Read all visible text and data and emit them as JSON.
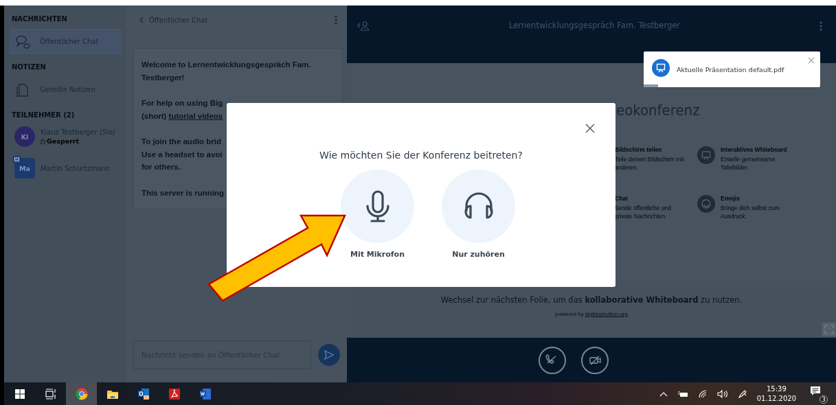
{
  "sidebar": {
    "sections": [
      {
        "title": "NACHRICHTEN",
        "items": [
          {
            "kind": "chat",
            "label": "Öffentlicher Chat",
            "selected": true
          }
        ]
      },
      {
        "title": "NOTIZEN",
        "items": [
          {
            "kind": "notes",
            "label": "Geteilte Notizen",
            "selected": false
          }
        ]
      }
    ],
    "participants": {
      "title": "TEILNEHMER (2)",
      "users": [
        {
          "kind": "viewer",
          "initials": "Kl",
          "name": "Klaus Testberger",
          "tag": "(Sie)",
          "status": "Gesperrt",
          "color": "#2b2766"
        },
        {
          "kind": "moderator",
          "initials": "Ma",
          "name": "Martin Schurtzmann",
          "color": "#1c3a70"
        }
      ]
    }
  },
  "chat": {
    "title": "Öffentlicher Chat",
    "paragraphs": [
      {
        "lines": [
          {
            "text": "Welcome to **Lernentwicklungsgespräch Fam.**"
          },
          {
            "text": "**Testberger**!"
          }
        ]
      },
      {
        "lines": [
          {
            "text": "For help on using Big"
          },
          {
            "text": "(short) ",
            "link": "tutorial videos"
          }
        ]
      },
      {
        "lines": [
          {
            "text": "To join the audio brid"
          },
          {
            "text": "Use a headset to avoi"
          },
          {
            "text": "for others."
          }
        ]
      },
      {
        "lines": [
          {
            "text": "This server is running"
          }
        ]
      }
    ],
    "placeholder": "Nachricht senden an Öffentlicher Chat"
  },
  "presentation": {
    "title": "Lernentwicklungsgespräch Fam. Testberger",
    "toast": {
      "text": "Aktuelle Präsentation default.pdf",
      "level": 0.08
    },
    "slide": {
      "title": "eokonferenz",
      "features": [
        {
          "kind": "screen",
          "title": "Bildschirm teilen",
          "text": "Teile deinen Bildschirm mit anderen."
        },
        {
          "kind": "whiteboard",
          "title": "Interaktives Whiteboard",
          "text": "Erstelle gemeinsame Tafelbilder."
        },
        {
          "kind": "chat",
          "title": "Chat",
          "text": "Sende öffentliche und private Nachrichten."
        },
        {
          "kind": "emoji",
          "title": "Emojis",
          "text": "Bringe dich selbst zum Ausdruck."
        }
      ],
      "footer": "Wechsel zur nächsten Folie, um das **kollaborative Whiteboard** zu nutzen.",
      "powered": "powered by ",
      "powered_link": "bigbluebutton.org"
    },
    "controls": [
      {
        "kind": "audio-off"
      },
      {
        "kind": "video-off"
      }
    ]
  },
  "modal": {
    "title": "Wie möchten Sie der Konferenz beitreten?",
    "options": [
      {
        "kind": "microphone",
        "label": "Mit Mikrofon"
      },
      {
        "kind": "headphones",
        "label": "Nur zuhören"
      }
    ]
  },
  "taskbar": {
    "apps": [
      {
        "kind": "start",
        "selected": false
      },
      {
        "kind": "taskview",
        "selected": false
      },
      {
        "kind": "chrome",
        "selected": true
      },
      {
        "kind": "explorer",
        "selected": false
      },
      {
        "kind": "outlook",
        "selected": false
      },
      {
        "kind": "acrobat",
        "selected": false
      },
      {
        "kind": "word",
        "selected": false
      }
    ],
    "time": "15:39",
    "date": "01.12.2020",
    "notifications": "3"
  }
}
